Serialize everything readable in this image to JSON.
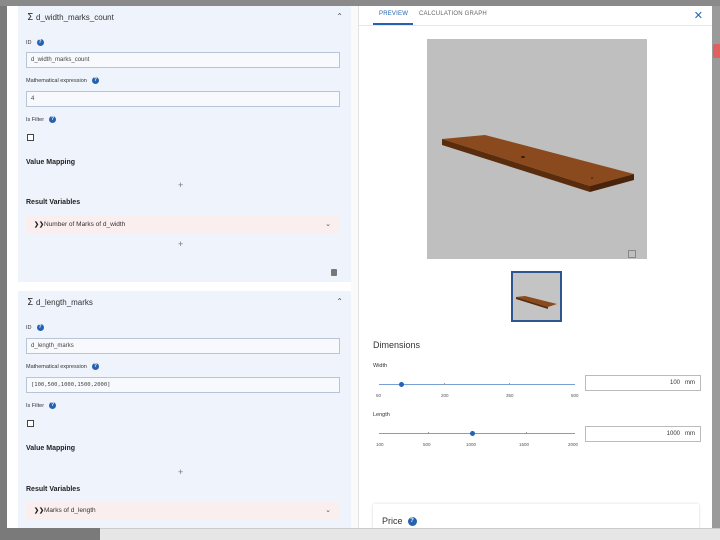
{
  "left": {
    "card1": {
      "title": "d_width_marks_count",
      "id_label": "ID",
      "id_value": "d_width_marks_count",
      "expr_label": "Mathematical expression",
      "expr_value": "4",
      "filter_label": "Is Filter",
      "value_mapping": "Value Mapping",
      "result_variables": "Result Variables",
      "result_item": "Number of Marks of d_width"
    },
    "card2": {
      "title": "d_length_marks",
      "id_label": "ID",
      "id_value": "d_length_marks",
      "expr_label": "Mathematical expression",
      "expr_value": "[100,500,1000,1500,2000]",
      "filter_label": "Is Filter",
      "value_mapping": "Value Mapping",
      "result_variables": "Result Variables",
      "result_item": "Marks of d_length"
    },
    "icons": {
      "sigma": "Σ",
      "chevron_up": "⌃",
      "chevron_down": "⌄",
      "plus": "+",
      "help": "?",
      "double_chevron": "❯❯"
    }
  },
  "right": {
    "tabs": [
      "PREVIEW",
      "CALCULATION GRAPH"
    ],
    "close": "✕",
    "dimensions_title": "Dimensions",
    "width": {
      "label": "Width",
      "value": "100",
      "unit": "mm",
      "ticks": [
        "50",
        "200",
        "350",
        "500"
      ],
      "min": 50,
      "max": 500,
      "current": 100
    },
    "length": {
      "label": "Length",
      "value": "1000",
      "unit": "mm",
      "ticks": [
        "100",
        "500",
        "1000",
        "1500",
        "2000"
      ],
      "min": 100,
      "max": 2000,
      "current": 1000
    },
    "price_title": "Price",
    "price_help": "?"
  },
  "colors": {
    "accent": "#2563b0",
    "card_bg": "#eef3fc",
    "result_bg": "#fbeeee",
    "wood": "#8a4a1e"
  }
}
